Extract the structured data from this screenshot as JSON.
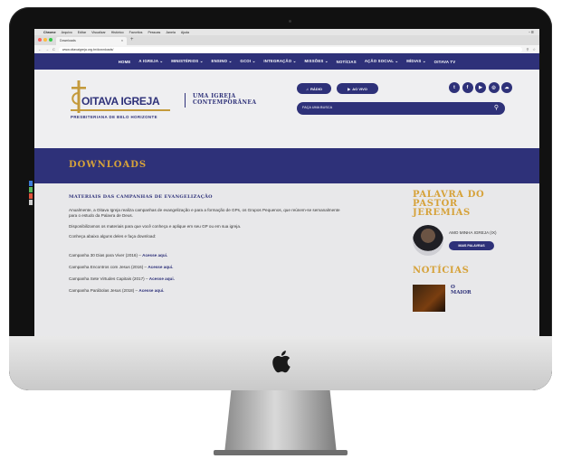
{
  "mac_menu": [
    "Chrome",
    "Arquivo",
    "Editar",
    "Visualizar",
    "Histórico",
    "Favoritos",
    "Pessoas",
    "Janela",
    "Ajuda"
  ],
  "browser": {
    "tab_title": "Downloads",
    "tab_close": "×",
    "new_tab": "+",
    "url": "www.oitavaigreja.org.br/downloads/"
  },
  "nav": {
    "items": [
      "HOME",
      "A IGREJA ⌄",
      "MINISTÉRIOS ⌄",
      "ENSINO ⌄",
      "GCOI ⌄",
      "INTEGRAÇÃO ⌄",
      "MISSÕES ⌄",
      "NOTÍCIAS",
      "AÇÃO SOCIAL ⌄",
      "MÍDIAS ⌄",
      "OITAVA TV"
    ]
  },
  "header": {
    "logo_name": "OITAVA IGREJA",
    "logo_subtitle": "PRESBITERIANA DE BELO HORIZONTE",
    "tagline_line1": "UMA IGREJA",
    "tagline_line2": "CONTEMPORÂNEA",
    "radio_label": "RÁDIO",
    "live_label": "AO VIVO",
    "search_placeholder": "FAÇA UMA BUSCA",
    "socials": [
      "t",
      "f",
      "▶",
      "◎",
      "☁"
    ]
  },
  "page_title": "DOWNLOADS",
  "main": {
    "heading": "MATERIAIS DAS CAMPANHAS DE EVANGELIZAÇÃO",
    "paragraphs": [
      "Anualmente, a Oitava Igreja realiza campanhas de evangelização e para a formação de GPs, os Grupos Pequenos, que reúnem-se semanalmente para o estudo da Palavra de Deus.",
      "Disponibilizamos os materiais para que você conheça e aplique em seu GP ou em sua igreja.",
      "Conheça abaixo alguns deles e faça download:"
    ],
    "campaigns": [
      {
        "name": "Campanha 30 Dias para Viver (2016) – ",
        "link": "Acesse aqui."
      },
      {
        "name": "Campanha Encontros com Jesus (2016) – ",
        "link": "Acesse aqui."
      },
      {
        "name": "Campanha Sete Virtudes Capitais (2017) – ",
        "link": "Acesse aqui."
      },
      {
        "name": "Campanha Parábolas Jesus (2018) – ",
        "link": "Acesse aqui."
      }
    ]
  },
  "aside": {
    "pastor_heading_1": "PALAVRA DO",
    "pastor_heading_2": "PASTOR",
    "pastor_heading_3": "JEREMIAS",
    "pastor_post": "AMO MINHA IGREJA (IX)",
    "more_button": "MAIS PALAVRAS",
    "news_heading": "NOTÍCIAS",
    "news_item_1": "O",
    "news_item_2": "MAIOR"
  },
  "colors": {
    "brand_blue": "#2e3179",
    "brand_gold": "#d6a23a"
  }
}
